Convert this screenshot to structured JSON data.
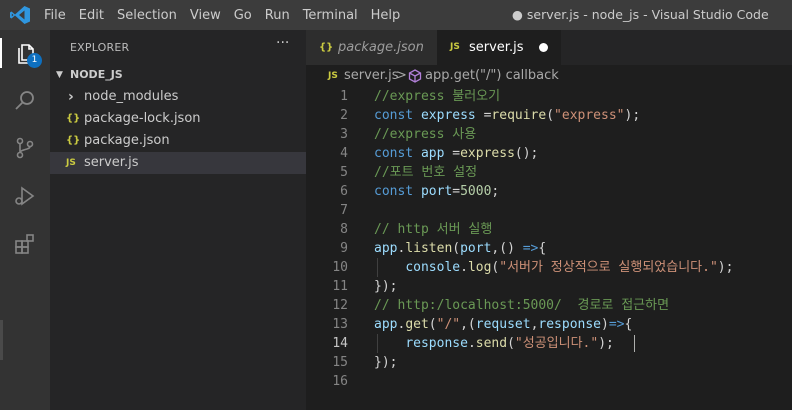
{
  "titlebar": {
    "menu": [
      "File",
      "Edit",
      "Selection",
      "View",
      "Go",
      "Run",
      "Terminal",
      "Help"
    ],
    "window_title": "● server.js - node_js - Visual Studio Code"
  },
  "activity_bar": {
    "icons": [
      "explorer-icon",
      "search-icon",
      "source-control-icon",
      "run-debug-icon",
      "extensions-icon"
    ],
    "explorer_badge": "1"
  },
  "sidebar": {
    "title": "EXPLORER",
    "more": "···",
    "section": "NODE_JS",
    "items": [
      {
        "icon": "›",
        "label": "node_modules"
      },
      {
        "icon": "{}",
        "label": "package-lock.json"
      },
      {
        "icon": "{}",
        "label": "package.json"
      },
      {
        "icon": "JS",
        "label": "server.js"
      }
    ]
  },
  "tabs": [
    {
      "icon": "{}",
      "label": "package.json"
    },
    {
      "icon": "JS",
      "label": "server.js"
    }
  ],
  "breadcrumb": {
    "file_icon": "JS",
    "file": "server.js",
    "separator": ">",
    "symbol": "app.get(\"/\") callback"
  },
  "editor": {
    "line_numbers": [
      "1",
      "2",
      "3",
      "4",
      "5",
      "6",
      "7",
      "8",
      "9",
      "10",
      "11",
      "12",
      "13",
      "14",
      "15",
      "16"
    ],
    "active_line": "14",
    "lines": [
      [
        {
          "t": "//express 불러오기",
          "c": "c"
        }
      ],
      [
        {
          "t": "const ",
          "c": "k"
        },
        {
          "t": "express",
          "c": "v"
        },
        {
          "t": " =",
          "c": "p"
        },
        {
          "t": "require",
          "c": "f"
        },
        {
          "t": "(",
          "c": "p"
        },
        {
          "t": "\"express\"",
          "c": "s"
        },
        {
          "t": ");",
          "c": "p"
        }
      ],
      [
        {
          "t": "//express 사용",
          "c": "c"
        }
      ],
      [
        {
          "t": "const ",
          "c": "k"
        },
        {
          "t": "app",
          "c": "v"
        },
        {
          "t": " =",
          "c": "p"
        },
        {
          "t": "express",
          "c": "f"
        },
        {
          "t": "();",
          "c": "p"
        }
      ],
      [
        {
          "t": "//포트 번호 설정",
          "c": "c"
        }
      ],
      [
        {
          "t": "const ",
          "c": "k"
        },
        {
          "t": "port",
          "c": "v"
        },
        {
          "t": "=",
          "c": "p"
        },
        {
          "t": "5000",
          "c": "n"
        },
        {
          "t": ";",
          "c": "p"
        }
      ],
      [],
      [
        {
          "t": "// http 서버 실행",
          "c": "c"
        }
      ],
      [
        {
          "t": "app",
          "c": "v"
        },
        {
          "t": ".",
          "c": "p"
        },
        {
          "t": "listen",
          "c": "f"
        },
        {
          "t": "(",
          "c": "p"
        },
        {
          "t": "port",
          "c": "v"
        },
        {
          "t": ",() ",
          "c": "p"
        },
        {
          "t": "=>",
          "c": "k"
        },
        {
          "t": "{",
          "c": "p"
        }
      ],
      [
        {
          "t": "    ",
          "c": "p"
        },
        {
          "t": "console",
          "c": "v"
        },
        {
          "t": ".",
          "c": "p"
        },
        {
          "t": "log",
          "c": "f"
        },
        {
          "t": "(",
          "c": "p"
        },
        {
          "t": "\"서버가 정상적으로 실행되었습니다.\"",
          "c": "s"
        },
        {
          "t": ");",
          "c": "p"
        }
      ],
      [
        {
          "t": "});",
          "c": "p"
        }
      ],
      [
        {
          "t": "// http:/localhost:5000/  경로로 접근하면",
          "c": "c"
        }
      ],
      [
        {
          "t": "app",
          "c": "v"
        },
        {
          "t": ".",
          "c": "p"
        },
        {
          "t": "get",
          "c": "f"
        },
        {
          "t": "(",
          "c": "p"
        },
        {
          "t": "\"/\"",
          "c": "s"
        },
        {
          "t": ",(",
          "c": "p"
        },
        {
          "t": "requset",
          "c": "v"
        },
        {
          "t": ",",
          "c": "p"
        },
        {
          "t": "response",
          "c": "v"
        },
        {
          "t": ")",
          "c": "p"
        },
        {
          "t": "=>",
          "c": "k"
        },
        {
          "t": "{",
          "c": "p"
        }
      ],
      [
        {
          "t": "    ",
          "c": "p"
        },
        {
          "t": "response",
          "c": "v"
        },
        {
          "t": ".",
          "c": "p"
        },
        {
          "t": "send",
          "c": "f"
        },
        {
          "t": "(",
          "c": "p"
        },
        {
          "t": "\"성공입니다.\"",
          "c": "s"
        },
        {
          "t": ");",
          "c": "p"
        }
      ],
      [
        {
          "t": "});",
          "c": "p"
        }
      ],
      []
    ]
  }
}
